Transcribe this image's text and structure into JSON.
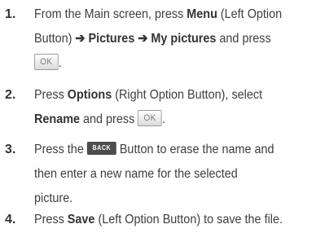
{
  "steps": [
    {
      "number": "1.",
      "lines": [
        [
          "From the Main screen, press ",
          {
            "b": "Menu"
          },
          " (Left Option"
        ],
        [
          "Button) ",
          {
            "b": "➔ Pictures ➔ My pictures"
          },
          " and press"
        ],
        [
          {
            "key": "ok"
          },
          "."
        ]
      ]
    },
    {
      "number": "2.",
      "lines": [
        [
          "Press ",
          {
            "b": "Options"
          },
          " (Right Option Button), select"
        ],
        [
          {
            "b": "Rename"
          },
          " and press ",
          {
            "key": "ok"
          },
          "."
        ]
      ]
    },
    {
      "number": "3.",
      "lines": [
        [
          "Press the ",
          {
            "key": "back"
          },
          " Button to erase the name and"
        ],
        [
          "then enter a new name for the selected"
        ],
        [
          "picture."
        ]
      ]
    },
    {
      "number": "4.",
      "lines": [
        [
          "Press ",
          {
            "b": "Save"
          },
          " (Left Option Button) to save the file."
        ]
      ]
    }
  ],
  "keys": {
    "ok": "OK",
    "back": "BACK"
  }
}
